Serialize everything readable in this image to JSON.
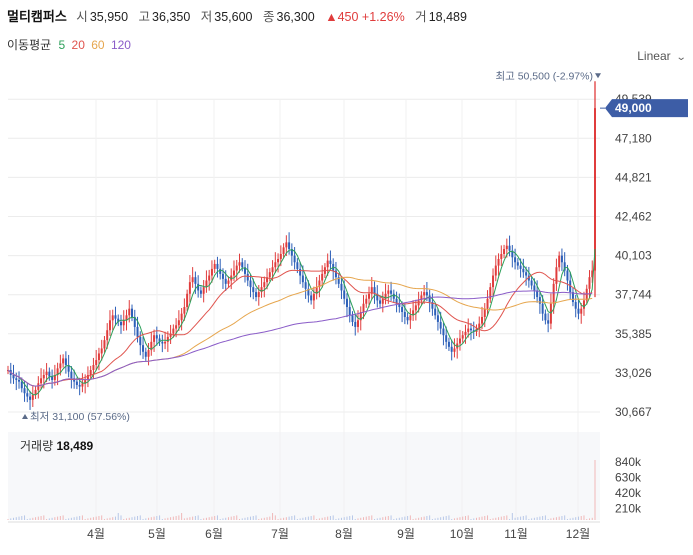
{
  "header": {
    "name": "멀티캠퍼스",
    "open_label": "시",
    "open": "35,950",
    "high_label": "고",
    "high": "36,350",
    "low_label": "저",
    "low": "35,600",
    "close_label": "종",
    "close": "36,300",
    "change": "▲450 +1.26%",
    "volume_label": "거",
    "volume": "18,489"
  },
  "ma_legend": {
    "label": "이동평균",
    "periods": [
      "5",
      "20",
      "60",
      "120"
    ]
  },
  "scale_mode": "Linear",
  "colors": {
    "up": "#e03c3c",
    "down": "#2c5fb8",
    "ma5": "#2da05a",
    "ma20": "#e0544e",
    "ma60": "#e6a64e",
    "ma120": "#8a5cc8",
    "price_tag": "#3d5da6",
    "grid": "#ececec"
  },
  "chart_data": {
    "type": "candlestick",
    "y_ticks": [
      "30,667",
      "33,026",
      "35,385",
      "37,744",
      "40,103",
      "42,462",
      "44,821",
      "47,180",
      "49,539"
    ],
    "ylim": [
      30667,
      49539
    ],
    "x_ticks": [
      "4월",
      "5월",
      "6월",
      "7월",
      "8월",
      "9월",
      "10월",
      "11월",
      "12월"
    ],
    "current_price": "49,000",
    "max_annotation": "최고 50,500 (-2.97%)",
    "min_annotation": "최저 31,100 (57.56%)",
    "close_series": [
      33200,
      32900,
      32700,
      32600,
      32500,
      32100,
      31800,
      31600,
      31400,
      31700,
      32000,
      32400,
      32700,
      32900,
      33100,
      32800,
      32600,
      32900,
      33300,
      33600,
      33900,
      33500,
      33100,
      32700,
      32500,
      32300,
      32200,
      32400,
      32600,
      32900,
      33200,
      33500,
      33800,
      34200,
      34500,
      35000,
      35600,
      36200,
      36500,
      36300,
      36100,
      35900,
      36200,
      36500,
      36900,
      36400,
      35800,
      35200,
      34700,
      34300,
      34000,
      34400,
      34900,
      35300,
      35100,
      34900,
      34800,
      34900,
      35200,
      35400,
      35700,
      35900,
      36200,
      36600,
      37000,
      37800,
      38500,
      38800,
      38400,
      38000,
      37800,
      38200,
      38600,
      38900,
      39300,
      39600,
      39300,
      39000,
      38700,
      38400,
      38600,
      38900,
      39200,
      39500,
      39700,
      39400,
      39000,
      38600,
      38200,
      37900,
      37600,
      37900,
      38200,
      38500,
      38800,
      39100,
      39400,
      39700,
      39900,
      40200,
      40600,
      40900,
      40500,
      40100,
      39700,
      39300,
      38900,
      38500,
      38100,
      37700,
      37400,
      37800,
      38200,
      38600,
      39000,
      39400,
      39800,
      39600,
      39200,
      38800,
      38400,
      38000,
      37500,
      37000,
      36500,
      36100,
      35800,
      36200,
      36700,
      37200,
      37500,
      37800,
      38200,
      37800,
      37400,
      37200,
      37500,
      37800,
      38000,
      37800,
      37500,
      37200,
      37000,
      36700,
      36400,
      36200,
      36500,
      36800,
      37100,
      37400,
      37700,
      37900,
      37700,
      37300,
      36900,
      36500,
      36100,
      35700,
      35300,
      34900,
      34600,
      34300,
      34500,
      34800,
      35100,
      35300,
      35500,
      35700,
      35600,
      35500,
      35700,
      36000,
      36400,
      36900,
      37500,
      38200,
      38900,
      39500,
      39900,
      40200,
      40500,
      40700,
      40400,
      40000,
      39700,
      39500,
      39300,
      39100,
      38900,
      38600,
      38300,
      38000,
      37600,
      37200,
      36600,
      36200,
      36000,
      37200,
      38400,
      39400,
      40100,
      39700,
      39200,
      38600,
      37900,
      37300,
      36900,
      36600,
      36900,
      37400,
      38100,
      38800,
      39200,
      49000
    ],
    "volume_max_label": "840k",
    "volume_ticks": [
      "840k",
      "630k",
      "420k",
      "210k"
    ],
    "volume_label": "거래량",
    "volume_value": "18,489"
  }
}
